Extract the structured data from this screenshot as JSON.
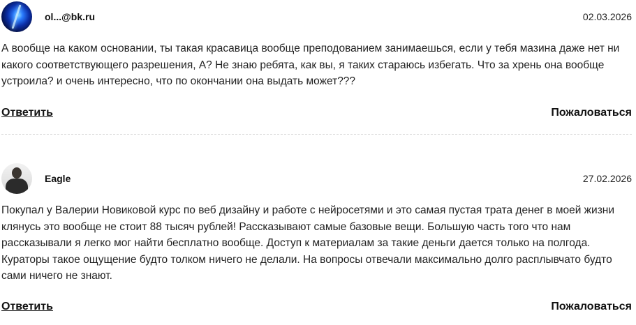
{
  "comments": [
    {
      "author": "ol...@bk.ru",
      "date": "02.03.2026",
      "text": "А вообще на каком основании, ты такая красавица вообще преподованием занимаешься, если у тебя мазина даже нет ни какого соответствующего разрешения, А? Не знаю ребята, как вы, я таких стараюсь избегать. Что за хрень она вообще устроила? и очень интересно, что по окончании она выдать может???",
      "reply_label": "Ответить",
      "complain_label": "Пожаловаться",
      "avatar_icon": "blue-light-avatar"
    },
    {
      "author": "Eagle",
      "date": "27.02.2026",
      "text": "Покупал у Валерии Новиковой курс по веб дизайну и работе с нейросетями и это самая пустая трата денег в моей жизни клянусь это вообще не стоит 88 тысяч рублей! Рассказывают самые базовые вещи. Большую часть того что нам рассказывали я легко мог найти бесплатно вообще. Доступ к материалам за такие деньги дается только на полгода. Кураторы такое ощущение будто толком ничего не делали. На вопросы отвечали максимально долго расплывчато будто сами ничего не знают.",
      "reply_label": "Ответить",
      "complain_label": "Пожаловаться",
      "avatar_icon": "person-photo-avatar"
    }
  ]
}
